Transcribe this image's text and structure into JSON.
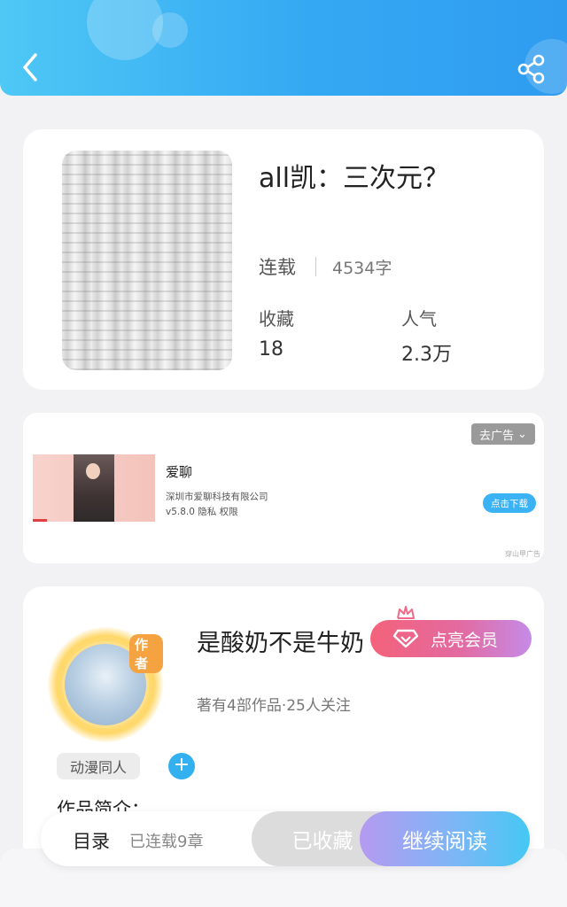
{
  "header": {
    "back_icon": "chevron-left-icon",
    "share_icon": "share-icon"
  },
  "book": {
    "title": "all凯：三次元？",
    "status": "连载",
    "word_count": "4534字",
    "favorites_label": "收藏",
    "favorites_value": "18",
    "popularity_label": "人气",
    "popularity_value": "2.3万"
  },
  "ad": {
    "close_label": "去广告",
    "app_name": "爱聊",
    "company": "深圳市爱聊科技有限公司",
    "version_line": "v5.8.0  隐私  权限",
    "download_label": "点击下载",
    "source": "穿山甲广告"
  },
  "author": {
    "badge": "作者",
    "name": "是酸奶不是牛奶",
    "vip_label": "点亮会员",
    "meta": "著有4部作品·25人关注",
    "tag": "动漫同人",
    "add_symbol": "+",
    "intro_label": "作品简介："
  },
  "bottom_bar": {
    "toc_label": "目录",
    "chapters": "已连载9章",
    "collected_label": "已收藏",
    "read_label": "继续阅读"
  },
  "colors": {
    "header_gradient_start": "#4ec8f5",
    "header_gradient_end": "#2f9cf0",
    "vip_gradient_start": "#f4627a",
    "vip_gradient_end": "#c58be8",
    "read_gradient_start": "#b59af0",
    "read_gradient_end": "#45c8f4",
    "accent_blue": "#33b0ef"
  }
}
